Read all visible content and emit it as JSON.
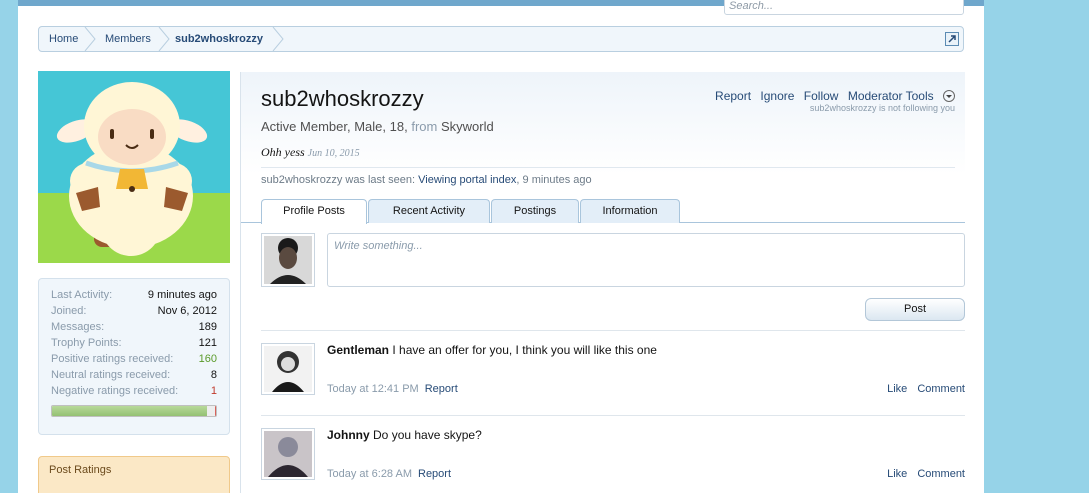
{
  "search": {
    "placeholder": "Search..."
  },
  "breadcrumb": [
    "Home",
    "Members",
    "sub2whoskrozzy"
  ],
  "profile": {
    "username": "sub2whoskrozzy",
    "title": "Active Member",
    "gender": "Male",
    "age": "18",
    "from_label": "from",
    "location": "Skyworld",
    "status_text": "Ohh yess",
    "status_date": "Jun 10, 2015",
    "last_seen_prefix": "sub2whoskrozzy was last seen:",
    "last_seen_action": "Viewing portal",
    "last_seen_link": "index",
    "last_seen_time": "9 minutes ago",
    "actions": [
      "Report",
      "Ignore",
      "Follow",
      "Moderator Tools"
    ],
    "follow_note": "sub2whoskrozzy is not following you"
  },
  "stats": [
    {
      "label": "Last Activity:",
      "value": "9 minutes ago",
      "color": "#141414"
    },
    {
      "label": "Joined:",
      "value": "Nov 6, 2012",
      "color": "#141414"
    },
    {
      "label": "Messages:",
      "value": "189",
      "color": "#141414"
    },
    {
      "label": "Trophy Points:",
      "value": "121",
      "color": "#141414"
    },
    {
      "label": "Positive ratings received:",
      "value": "160",
      "color": "#5a9a2a"
    },
    {
      "label": "Neutral ratings received:",
      "value": "8",
      "color": "#141414"
    },
    {
      "label": "Negative ratings received:",
      "value": "1",
      "color": "#c0392b"
    }
  ],
  "rating_bar": {
    "positive": 160,
    "neutral": 8,
    "negative": 1
  },
  "post_ratings_title": "Post Ratings",
  "tabs": [
    "Profile Posts",
    "Recent Activity",
    "Postings",
    "Information"
  ],
  "compose_placeholder": "Write something...",
  "post_button": "Post",
  "messages": [
    {
      "author": "Gentleman",
      "text": "I have an offer for you, I think you will like this one",
      "time": "Today at 12:41 PM",
      "report": "Report",
      "like": "Like",
      "comment": "Comment"
    },
    {
      "author": "Johnny",
      "text": "Do you have skype?",
      "time": "Today at 6:28 AM",
      "report": "Report",
      "like": "Like",
      "comment": "Comment"
    }
  ]
}
